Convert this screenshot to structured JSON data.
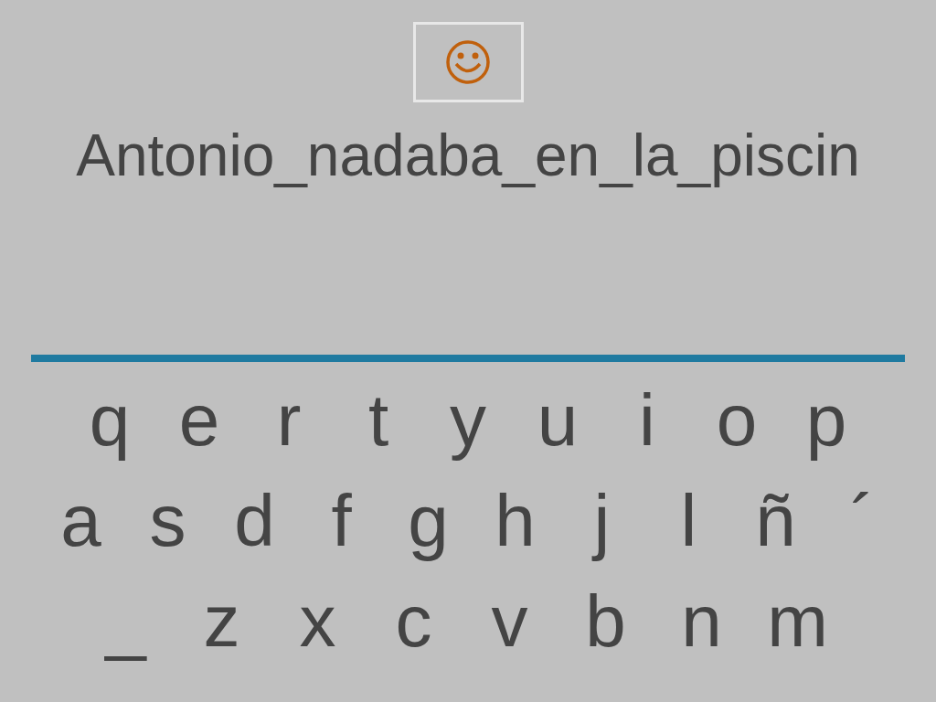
{
  "answer_text": "Antonio_nadaba_en_la_piscin",
  "keyboard_rows": [
    [
      "q",
      "e",
      "r",
      "t",
      "y",
      "u",
      "i",
      "o",
      "p"
    ],
    [
      "a",
      "s",
      "d",
      "f",
      "g",
      "h",
      "j",
      "l",
      "ñ",
      "´"
    ],
    [
      "_",
      "z",
      "x",
      "c",
      "v",
      "b",
      "n",
      "m"
    ]
  ]
}
